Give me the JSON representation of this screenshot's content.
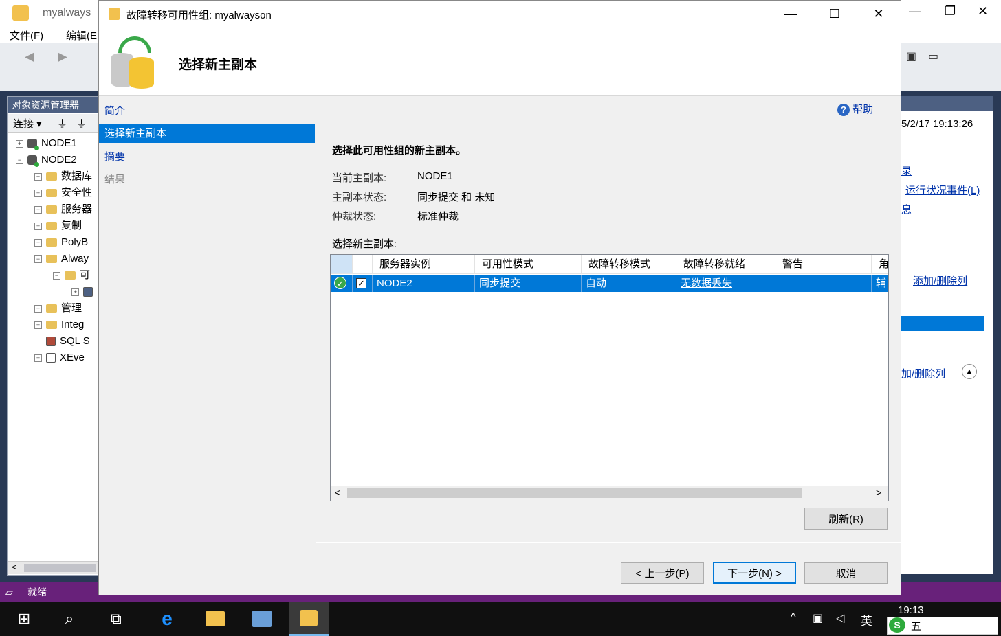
{
  "bg_app": {
    "title": "myalways",
    "menu": [
      "文件(F)",
      "编辑(E"
    ],
    "window_controls": [
      "—",
      "❐",
      "✕"
    ]
  },
  "object_explorer": {
    "header": "对象资源管理器",
    "connect_label": "连接",
    "tree": [
      {
        "label": "NODE1",
        "indent": 0,
        "expander": "+",
        "icon": "server-icon"
      },
      {
        "label": "NODE2",
        "indent": 0,
        "expander": "-",
        "icon": "server-icon"
      },
      {
        "label": "数据库",
        "indent": 1,
        "expander": "+",
        "icon": "folder-icon"
      },
      {
        "label": "安全性",
        "indent": 1,
        "expander": "+",
        "icon": "folder-icon"
      },
      {
        "label": "服务器",
        "indent": 1,
        "expander": "+",
        "icon": "folder-icon"
      },
      {
        "label": "复制",
        "indent": 1,
        "expander": "+",
        "icon": "folder-icon"
      },
      {
        "label": "PolyB",
        "indent": 1,
        "expander": "+",
        "icon": "folder-icon"
      },
      {
        "label": "Alway",
        "indent": 1,
        "expander": "-",
        "icon": "folder-icon"
      },
      {
        "label": "可",
        "indent": 2,
        "expander": "-",
        "icon": "folder-icon"
      },
      {
        "label": "",
        "indent": 3,
        "expander": "+",
        "icon": "ag-icon"
      },
      {
        "label": "管理",
        "indent": 1,
        "expander": "+",
        "icon": "folder-icon"
      },
      {
        "label": "Integ",
        "indent": 1,
        "expander": "+",
        "icon": "folder-icon"
      },
      {
        "label": "SQL S",
        "indent": 1,
        "expander": "",
        "icon": "agent-icon"
      },
      {
        "label": "XEve",
        "indent": 1,
        "expander": "+",
        "icon": "xevents-icon"
      }
    ]
  },
  "right_panel": {
    "timestamp": "5/2/17 19:13:26",
    "link1": "录",
    "link2": "运行状况事件(L)",
    "link3": "息",
    "add_remove_cols_1": "添加/删除列",
    "add_remove_cols_2": "加/删除列"
  },
  "status_bar": {
    "text": "就绪"
  },
  "taskbar": {
    "clock": "19:13",
    "ime": "英",
    "ime_tray": "五"
  },
  "dialog": {
    "title": "故障转移可用性组: myalwayson",
    "header_title": "选择新主副本",
    "nav": [
      {
        "label": "简介",
        "state": "link"
      },
      {
        "label": "选择新主副本",
        "state": "selected"
      },
      {
        "label": "摘要",
        "state": "link"
      },
      {
        "label": "结果",
        "state": "disabled"
      }
    ],
    "help_label": "帮助",
    "instruction": "选择此可用性组的新主副本。",
    "info": [
      {
        "label": "当前主副本:",
        "value": "NODE1"
      },
      {
        "label": "主副本状态:",
        "value": "同步提交 和 未知"
      },
      {
        "label": "仲裁状态:",
        "value": "标准仲裁"
      }
    ],
    "grid_label": "选择新主副本:",
    "grid": {
      "columns": [
        "",
        "",
        "服务器实例",
        "可用性模式",
        "故障转移模式",
        "故障转移就绪",
        "警告",
        "角"
      ],
      "rows": [
        {
          "server": "NODE2",
          "availability_mode": "同步提交",
          "failover_mode": "自动",
          "failover_readiness": "无数据丢失",
          "warning": "",
          "role": "辅",
          "checked": true,
          "status": "ok"
        }
      ]
    },
    "refresh_button": "刷新(R)",
    "back_button": "< 上一步(P)",
    "next_button": "下一步(N) >",
    "cancel_button": "取消",
    "colors": {
      "selection": "#0078d7",
      "nav_link": "#0033aa",
      "header_band": "#4d6082"
    }
  }
}
